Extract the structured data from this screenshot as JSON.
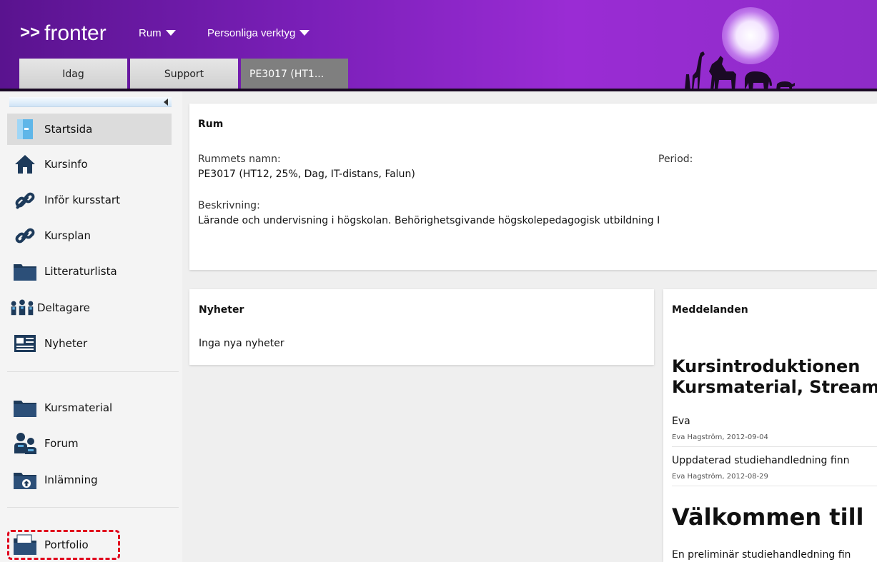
{
  "header": {
    "logo_chevrons": ">>",
    "logo_text": "fronter",
    "menu_rum": "Rum",
    "menu_personliga": "Personliga verktyg",
    "tabs": [
      {
        "label": "Idag"
      },
      {
        "label": "Support"
      },
      {
        "label": "PE3017 (HT1..."
      }
    ]
  },
  "sidebar": {
    "items": [
      {
        "label": "Startsida",
        "icon": "door-icon"
      },
      {
        "label": "Kursinfo",
        "icon": "home-icon"
      },
      {
        "label": "Inför kursstart",
        "icon": "link-icon"
      },
      {
        "label": "Kursplan",
        "icon": "link-icon"
      },
      {
        "label": "Litteraturlista",
        "icon": "folder-icon"
      },
      {
        "label": "Deltagare",
        "icon": "people-icon"
      },
      {
        "label": "Nyheter",
        "icon": "news-icon"
      },
      {
        "label": "Kursmaterial",
        "icon": "folder-icon"
      },
      {
        "label": "Forum",
        "icon": "forum-icon"
      },
      {
        "label": "Inlämning",
        "icon": "upload-folder-icon"
      },
      {
        "label": "Portfolio",
        "icon": "portfolio-icon"
      }
    ]
  },
  "room_panel": {
    "title": "Rum",
    "name_label": "Rummets namn:",
    "name_value": "PE3017 (HT12, 25%, Dag, IT-distans, Falun)",
    "period_label": "Period:",
    "desc_label": "Beskrivning:",
    "desc_value": "Lärande och undervisning i högskolan. Behörighetsgivande högskolepedagogisk utbildning I"
  },
  "news_panel": {
    "title": "Nyheter",
    "empty_text": "Inga nya nyheter"
  },
  "messages_panel": {
    "title": "Meddelanden",
    "heading1_line1": "Kursintroduktionen",
    "heading1_line2": "Kursmaterial, Stream",
    "messages": [
      {
        "text": "Eva",
        "meta": "Eva Hagström,  2012-09-04"
      },
      {
        "text": "Uppdaterad studiehandledning finn",
        "meta": "Eva Hagström,  2012-08-29"
      }
    ],
    "heading2": "Välkommen till",
    "footer_text": "En preliminär studiehandledning fin"
  },
  "colors": {
    "header_purple": "#7a1fb8",
    "highlight_red": "#e0001b"
  }
}
